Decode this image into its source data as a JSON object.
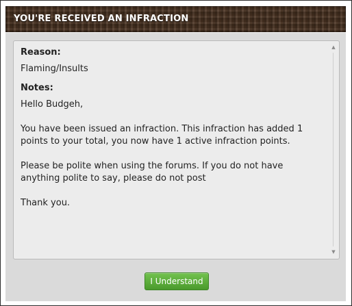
{
  "dialog": {
    "title": "YOU'RE RECEIVED AN INFRACTION",
    "reason_label": "Reason:",
    "reason_value": "Flaming/Insults",
    "notes_label": "Notes:",
    "notes": [
      "Hello Budgeh,",
      "You have been issued an infraction. This infraction has added 1 points to your total, you now have 1 active infraction points.",
      "Please be polite when using the forums. If you do not have anything polite to say, please do not post",
      "Thank you."
    ],
    "confirm_button": "I Understand"
  },
  "colors": {
    "title_bg": "#4a3322",
    "panel_bg": "#ececec",
    "body_bg": "#dadada",
    "button_green": "#5cae3a"
  },
  "icons": {
    "scroll_up": "scroll-up-arrow-icon",
    "scroll_down": "scroll-down-arrow-icon"
  }
}
